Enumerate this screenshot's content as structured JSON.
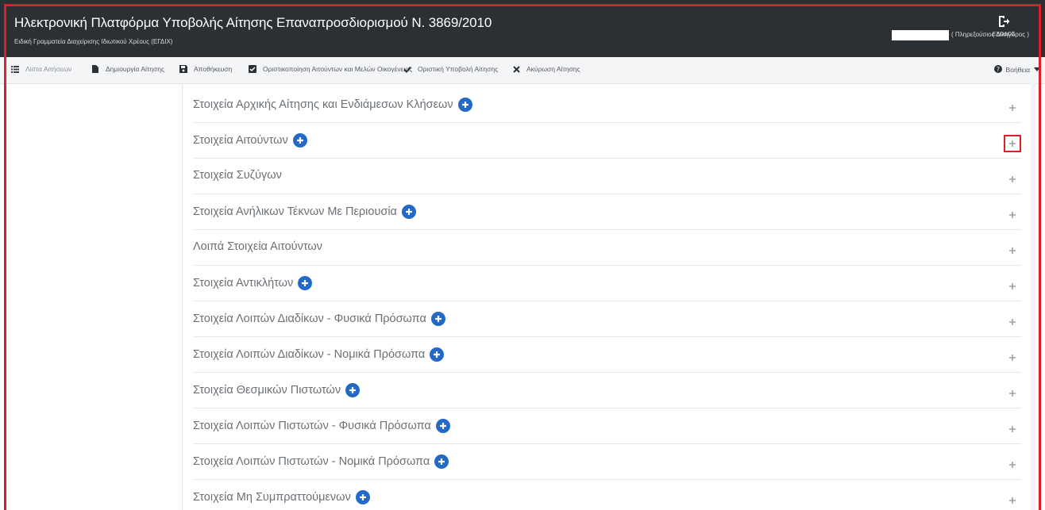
{
  "header": {
    "title": "Ηλεκτρονική Πλατφόρμα Υποβολής Αίτησης Επαναπροσδιορισμού Ν. 3869/2010",
    "subtitle": "Ειδική Γραμματεία Διαχείρισης Ιδιωτικού Χρέους (ΕΓΔΙΧ)",
    "user_role": "( Πληρεξούσιος Δικηγόρος )",
    "logout_label": "ΕΞΟΔΟΣ"
  },
  "toolbar": {
    "items": [
      {
        "label": "Λίστα Αιτήσεων",
        "icon": "list-icon"
      },
      {
        "label": "Δημιουργία Αίτησης",
        "icon": "file-icon"
      },
      {
        "label": "Αποθήκευση",
        "icon": "save-icon"
      },
      {
        "label": "Οριστικοποίηση Αιτούντων και Μελών Οικογένειας",
        "icon": "check-square-icon"
      },
      {
        "label": "Οριστική Υποβολή Αίτησης",
        "icon": "check-icon"
      },
      {
        "label": "Ακύρωση Αίτησης",
        "icon": "times-icon"
      }
    ],
    "help_label": "Βοήθεια"
  },
  "sections": [
    {
      "title": "Στοιχεία Αρχικής Αίτησης και Ενδιάμεσων Κλήσεων",
      "has_add": true
    },
    {
      "title": "Στοιχεία Αιτούντων",
      "has_add": true
    },
    {
      "title": "Στοιχεία Συζύγων",
      "has_add": false
    },
    {
      "title": "Στοιχεία Ανήλικων Τέκνων Με Περιουσία",
      "has_add": true
    },
    {
      "title": "Λοιπά Στοιχεία Αιτούντων",
      "has_add": false
    },
    {
      "title": "Στοιχεία Αντικλήτων",
      "has_add": true
    },
    {
      "title": "Στοιχεία Λοιπών Διαδίκων - Φυσικά Πρόσωπα",
      "has_add": true
    },
    {
      "title": "Στοιχεία Λοιπών Διαδίκων - Νομικά Πρόσωπα",
      "has_add": true
    },
    {
      "title": "Στοιχεία Θεσμικών Πιστωτών",
      "has_add": true
    },
    {
      "title": "Στοιχεία Λοιπών Πιστωτών - Φυσικά Πρόσωπα",
      "has_add": true
    },
    {
      "title": "Στοιχεία Λοιπών Πιστωτών - Νομικά Πρόσωπα",
      "has_add": true
    },
    {
      "title": "Στοιχεία Μη Συμπραττούμενων",
      "has_add": true
    }
  ],
  "colors": {
    "header_bg": "#2b3035",
    "accent_blue": "#2469c7",
    "highlight_red": "#e01e2a"
  }
}
